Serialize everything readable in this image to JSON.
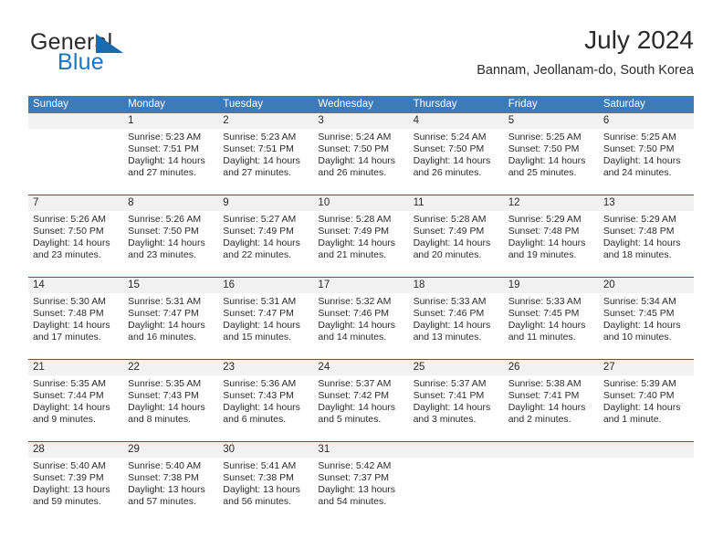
{
  "brand": {
    "name_part1": "General",
    "name_part2": "Blue",
    "triangle_color": "#1b6ab0",
    "blue_color": "#1b74c4"
  },
  "header": {
    "title": "July 2024",
    "subtitle": "Bannam, Jeollanam-do, South Korea"
  },
  "colors": {
    "header_bar": "#3c7ab8",
    "week_separator": "#2a6099",
    "daynum_band": "#f1f1f1"
  },
  "weekdays": [
    "Sunday",
    "Monday",
    "Tuesday",
    "Wednesday",
    "Thursday",
    "Friday",
    "Saturday"
  ],
  "labels": {
    "sunrise_prefix": "Sunrise:",
    "sunset_prefix": "Sunset:",
    "daylight_prefix": "Daylight:"
  },
  "weeks": [
    [
      {
        "day": "",
        "sunrise": "",
        "sunset": "",
        "daylight_line1": "",
        "daylight_line2": ""
      },
      {
        "day": "1",
        "sunrise": "Sunrise: 5:23 AM",
        "sunset": "Sunset: 7:51 PM",
        "daylight_line1": "Daylight: 14 hours",
        "daylight_line2": "and 27 minutes."
      },
      {
        "day": "2",
        "sunrise": "Sunrise: 5:23 AM",
        "sunset": "Sunset: 7:51 PM",
        "daylight_line1": "Daylight: 14 hours",
        "daylight_line2": "and 27 minutes."
      },
      {
        "day": "3",
        "sunrise": "Sunrise: 5:24 AM",
        "sunset": "Sunset: 7:50 PM",
        "daylight_line1": "Daylight: 14 hours",
        "daylight_line2": "and 26 minutes."
      },
      {
        "day": "4",
        "sunrise": "Sunrise: 5:24 AM",
        "sunset": "Sunset: 7:50 PM",
        "daylight_line1": "Daylight: 14 hours",
        "daylight_line2": "and 26 minutes."
      },
      {
        "day": "5",
        "sunrise": "Sunrise: 5:25 AM",
        "sunset": "Sunset: 7:50 PM",
        "daylight_line1": "Daylight: 14 hours",
        "daylight_line2": "and 25 minutes."
      },
      {
        "day": "6",
        "sunrise": "Sunrise: 5:25 AM",
        "sunset": "Sunset: 7:50 PM",
        "daylight_line1": "Daylight: 14 hours",
        "daylight_line2": "and 24 minutes."
      }
    ],
    [
      {
        "day": "7",
        "sunrise": "Sunrise: 5:26 AM",
        "sunset": "Sunset: 7:50 PM",
        "daylight_line1": "Daylight: 14 hours",
        "daylight_line2": "and 23 minutes."
      },
      {
        "day": "8",
        "sunrise": "Sunrise: 5:26 AM",
        "sunset": "Sunset: 7:50 PM",
        "daylight_line1": "Daylight: 14 hours",
        "daylight_line2": "and 23 minutes."
      },
      {
        "day": "9",
        "sunrise": "Sunrise: 5:27 AM",
        "sunset": "Sunset: 7:49 PM",
        "daylight_line1": "Daylight: 14 hours",
        "daylight_line2": "and 22 minutes."
      },
      {
        "day": "10",
        "sunrise": "Sunrise: 5:28 AM",
        "sunset": "Sunset: 7:49 PM",
        "daylight_line1": "Daylight: 14 hours",
        "daylight_line2": "and 21 minutes."
      },
      {
        "day": "11",
        "sunrise": "Sunrise: 5:28 AM",
        "sunset": "Sunset: 7:49 PM",
        "daylight_line1": "Daylight: 14 hours",
        "daylight_line2": "and 20 minutes."
      },
      {
        "day": "12",
        "sunrise": "Sunrise: 5:29 AM",
        "sunset": "Sunset: 7:48 PM",
        "daylight_line1": "Daylight: 14 hours",
        "daylight_line2": "and 19 minutes."
      },
      {
        "day": "13",
        "sunrise": "Sunrise: 5:29 AM",
        "sunset": "Sunset: 7:48 PM",
        "daylight_line1": "Daylight: 14 hours",
        "daylight_line2": "and 18 minutes."
      }
    ],
    [
      {
        "day": "14",
        "sunrise": "Sunrise: 5:30 AM",
        "sunset": "Sunset: 7:48 PM",
        "daylight_line1": "Daylight: 14 hours",
        "daylight_line2": "and 17 minutes."
      },
      {
        "day": "15",
        "sunrise": "Sunrise: 5:31 AM",
        "sunset": "Sunset: 7:47 PM",
        "daylight_line1": "Daylight: 14 hours",
        "daylight_line2": "and 16 minutes."
      },
      {
        "day": "16",
        "sunrise": "Sunrise: 5:31 AM",
        "sunset": "Sunset: 7:47 PM",
        "daylight_line1": "Daylight: 14 hours",
        "daylight_line2": "and 15 minutes."
      },
      {
        "day": "17",
        "sunrise": "Sunrise: 5:32 AM",
        "sunset": "Sunset: 7:46 PM",
        "daylight_line1": "Daylight: 14 hours",
        "daylight_line2": "and 14 minutes."
      },
      {
        "day": "18",
        "sunrise": "Sunrise: 5:33 AM",
        "sunset": "Sunset: 7:46 PM",
        "daylight_line1": "Daylight: 14 hours",
        "daylight_line2": "and 13 minutes."
      },
      {
        "day": "19",
        "sunrise": "Sunrise: 5:33 AM",
        "sunset": "Sunset: 7:45 PM",
        "daylight_line1": "Daylight: 14 hours",
        "daylight_line2": "and 11 minutes."
      },
      {
        "day": "20",
        "sunrise": "Sunrise: 5:34 AM",
        "sunset": "Sunset: 7:45 PM",
        "daylight_line1": "Daylight: 14 hours",
        "daylight_line2": "and 10 minutes."
      }
    ],
    [
      {
        "day": "21",
        "sunrise": "Sunrise: 5:35 AM",
        "sunset": "Sunset: 7:44 PM",
        "daylight_line1": "Daylight: 14 hours",
        "daylight_line2": "and 9 minutes."
      },
      {
        "day": "22",
        "sunrise": "Sunrise: 5:35 AM",
        "sunset": "Sunset: 7:43 PM",
        "daylight_line1": "Daylight: 14 hours",
        "daylight_line2": "and 8 minutes."
      },
      {
        "day": "23",
        "sunrise": "Sunrise: 5:36 AM",
        "sunset": "Sunset: 7:43 PM",
        "daylight_line1": "Daylight: 14 hours",
        "daylight_line2": "and 6 minutes."
      },
      {
        "day": "24",
        "sunrise": "Sunrise: 5:37 AM",
        "sunset": "Sunset: 7:42 PM",
        "daylight_line1": "Daylight: 14 hours",
        "daylight_line2": "and 5 minutes."
      },
      {
        "day": "25",
        "sunrise": "Sunrise: 5:37 AM",
        "sunset": "Sunset: 7:41 PM",
        "daylight_line1": "Daylight: 14 hours",
        "daylight_line2": "and 3 minutes."
      },
      {
        "day": "26",
        "sunrise": "Sunrise: 5:38 AM",
        "sunset": "Sunset: 7:41 PM",
        "daylight_line1": "Daylight: 14 hours",
        "daylight_line2": "and 2 minutes."
      },
      {
        "day": "27",
        "sunrise": "Sunrise: 5:39 AM",
        "sunset": "Sunset: 7:40 PM",
        "daylight_line1": "Daylight: 14 hours",
        "daylight_line2": "and 1 minute."
      }
    ],
    [
      {
        "day": "28",
        "sunrise": "Sunrise: 5:40 AM",
        "sunset": "Sunset: 7:39 PM",
        "daylight_line1": "Daylight: 13 hours",
        "daylight_line2": "and 59 minutes."
      },
      {
        "day": "29",
        "sunrise": "Sunrise: 5:40 AM",
        "sunset": "Sunset: 7:38 PM",
        "daylight_line1": "Daylight: 13 hours",
        "daylight_line2": "and 57 minutes."
      },
      {
        "day": "30",
        "sunrise": "Sunrise: 5:41 AM",
        "sunset": "Sunset: 7:38 PM",
        "daylight_line1": "Daylight: 13 hours",
        "daylight_line2": "and 56 minutes."
      },
      {
        "day": "31",
        "sunrise": "Sunrise: 5:42 AM",
        "sunset": "Sunset: 7:37 PM",
        "daylight_line1": "Daylight: 13 hours",
        "daylight_line2": "and 54 minutes."
      },
      {
        "day": "",
        "sunrise": "",
        "sunset": "",
        "daylight_line1": "",
        "daylight_line2": ""
      },
      {
        "day": "",
        "sunrise": "",
        "sunset": "",
        "daylight_line1": "",
        "daylight_line2": ""
      },
      {
        "day": "",
        "sunrise": "",
        "sunset": "",
        "daylight_line1": "",
        "daylight_line2": ""
      }
    ]
  ]
}
